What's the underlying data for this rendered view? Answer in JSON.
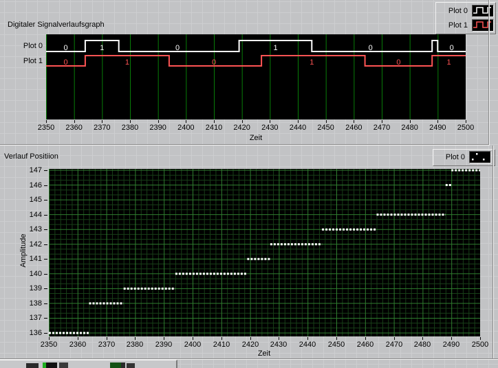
{
  "panel": {
    "top_section": {
      "title": "Digitaler Signalverlaufsgraph",
      "legend_items": [
        "Plot 0",
        "Plot 1"
      ],
      "row_labels": [
        "Plot 0",
        "Plot 1"
      ]
    },
    "bottom_section": {
      "title": "Verlauf Positiion",
      "legend_items": [
        "Plot 0"
      ]
    }
  },
  "chart_data": [
    {
      "type": "digital-timing",
      "title": "Digitaler Signalverlaufsgraph",
      "xlabel": "Zeit",
      "x_range": [
        2350,
        2500
      ],
      "x_ticks": [
        2350,
        2360,
        2370,
        2380,
        2390,
        2400,
        2410,
        2420,
        2430,
        2440,
        2450,
        2460,
        2470,
        2480,
        2490,
        2500
      ],
      "grid_color": "#087d08",
      "plots": [
        {
          "name": "Plot 0",
          "color": "#ffffff",
          "initial": 0,
          "transitions": [
            [
              2364,
              1
            ],
            [
              2376,
              0
            ],
            [
              2419,
              1
            ],
            [
              2445,
              0
            ],
            [
              2488,
              1
            ],
            [
              2490,
              0
            ]
          ],
          "labels": [
            {
              "x": 2357,
              "text": "0"
            },
            {
              "x": 2370,
              "text": "1"
            },
            {
              "x": 2397,
              "text": "0"
            },
            {
              "x": 2432,
              "text": "1"
            },
            {
              "x": 2466,
              "text": "0"
            },
            {
              "x": 2495,
              "text": "0"
            }
          ]
        },
        {
          "name": "Plot 1",
          "color": "#ff5454",
          "initial": 0,
          "transitions": [
            [
              2364,
              1
            ],
            [
              2394,
              0
            ],
            [
              2427,
              1
            ],
            [
              2464,
              0
            ],
            [
              2488,
              1
            ]
          ],
          "labels": [
            {
              "x": 2357,
              "text": "0"
            },
            {
              "x": 2379,
              "text": "1"
            },
            {
              "x": 2410,
              "text": "0"
            },
            {
              "x": 2445,
              "text": "1"
            },
            {
              "x": 2476,
              "text": "0"
            },
            {
              "x": 2494,
              "text": "1"
            }
          ]
        }
      ]
    },
    {
      "type": "scatter",
      "title": "Verlauf Positiion",
      "series_name": "Plot 0",
      "xlabel": "Zeit",
      "ylabel": "Amplitude",
      "x_range": [
        2350,
        2500
      ],
      "y_range": [
        136,
        147
      ],
      "x_ticks": [
        2350,
        2360,
        2370,
        2380,
        2390,
        2400,
        2410,
        2420,
        2430,
        2440,
        2450,
        2460,
        2470,
        2480,
        2490,
        2500
      ],
      "y_ticks": [
        136,
        137,
        138,
        139,
        140,
        141,
        142,
        143,
        144,
        145,
        146,
        147
      ],
      "grid": {
        "minor_x_step": 2,
        "major_x_step": 10,
        "minor_y_divisions": 3,
        "major_y_step": 1,
        "minor_color": "#183f18",
        "major_color": "#2f7d2f"
      },
      "point_color": "#ffffff",
      "runs": [
        {
          "y": 136,
          "x": [
            2350,
            2364
          ]
        },
        {
          "y": 138,
          "x": [
            2364,
            2376
          ]
        },
        {
          "y": 139,
          "x": [
            2376,
            2394
          ]
        },
        {
          "y": 140,
          "x": [
            2394,
            2419
          ]
        },
        {
          "y": 141,
          "x": [
            2419,
            2427
          ]
        },
        {
          "y": 142,
          "x": [
            2427,
            2445
          ]
        },
        {
          "y": 143,
          "x": [
            2445,
            2464
          ]
        },
        {
          "y": 144,
          "x": [
            2464,
            2488
          ]
        },
        {
          "y": 146,
          "x": [
            2488,
            2490
          ]
        },
        {
          "y": 147,
          "x": [
            2490,
            2500
          ]
        }
      ]
    }
  ]
}
